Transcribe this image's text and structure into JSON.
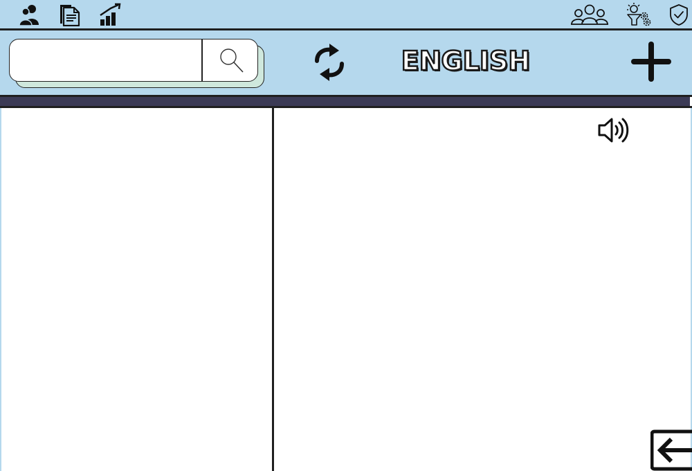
{
  "header": {
    "icons_left": [
      "users-icon",
      "document-icon",
      "growth-chart-icon"
    ],
    "icons_right": [
      "user-group-icon",
      "ideas-settings-icon",
      "shield-check-icon"
    ]
  },
  "toolbar": {
    "search": {
      "value": "",
      "placeholder": ""
    },
    "language_label": "ENGLISH",
    "refresh_icon": "refresh-icon",
    "add_icon": "plus-icon"
  },
  "content": {
    "speaker_icon": "speaker-icon",
    "back_icon": "exit-arrow-icon"
  },
  "colors": {
    "header_bg": "#b5d8ed",
    "band": "#3b3a55",
    "search_shadow": "#cfe8dd",
    "ink": "#1f1f1f"
  }
}
